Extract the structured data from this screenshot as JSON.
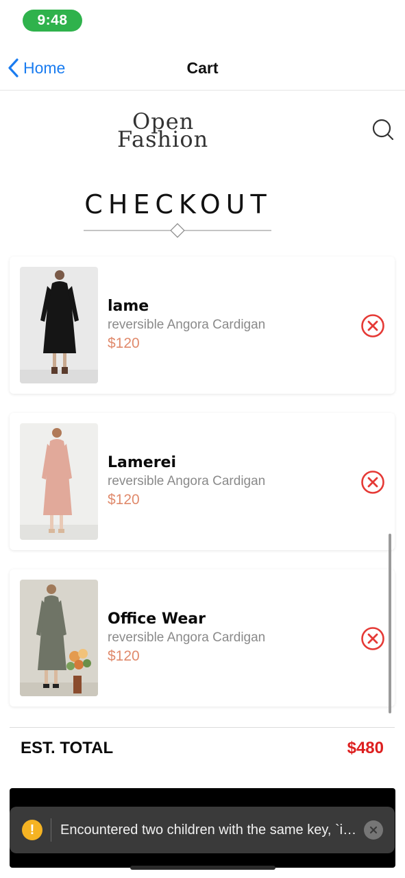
{
  "status_bar": {
    "time": "9:48"
  },
  "nav": {
    "back_label": "Home",
    "title": "Cart"
  },
  "header": {
    "logo_line1": "Open",
    "logo_line2": "Fashion",
    "checkout_title": "CHECKOUT"
  },
  "cart": {
    "items": [
      {
        "name": "lame",
        "description": "reversible Angora Cardigan",
        "price": "$120"
      },
      {
        "name": "Lamerei",
        "description": "reversible Angora Cardigan",
        "price": "$120"
      },
      {
        "name": "Office Wear",
        "description": "reversible Angora Cardigan",
        "price": "$120"
      }
    ]
  },
  "summary": {
    "total_label": "EST. TOTAL",
    "total_value": "$480"
  },
  "toast": {
    "message": "Encountered two children with the same key, `id`. Keys should be unique so that components maintain their identity across updates.",
    "icon": "warning-icon"
  },
  "colors": {
    "accent": "#1a7cf0",
    "price": "#e08a6c",
    "total": "#dd1f1f",
    "remove": "#e53935",
    "status_pill": "#2fb24c"
  }
}
